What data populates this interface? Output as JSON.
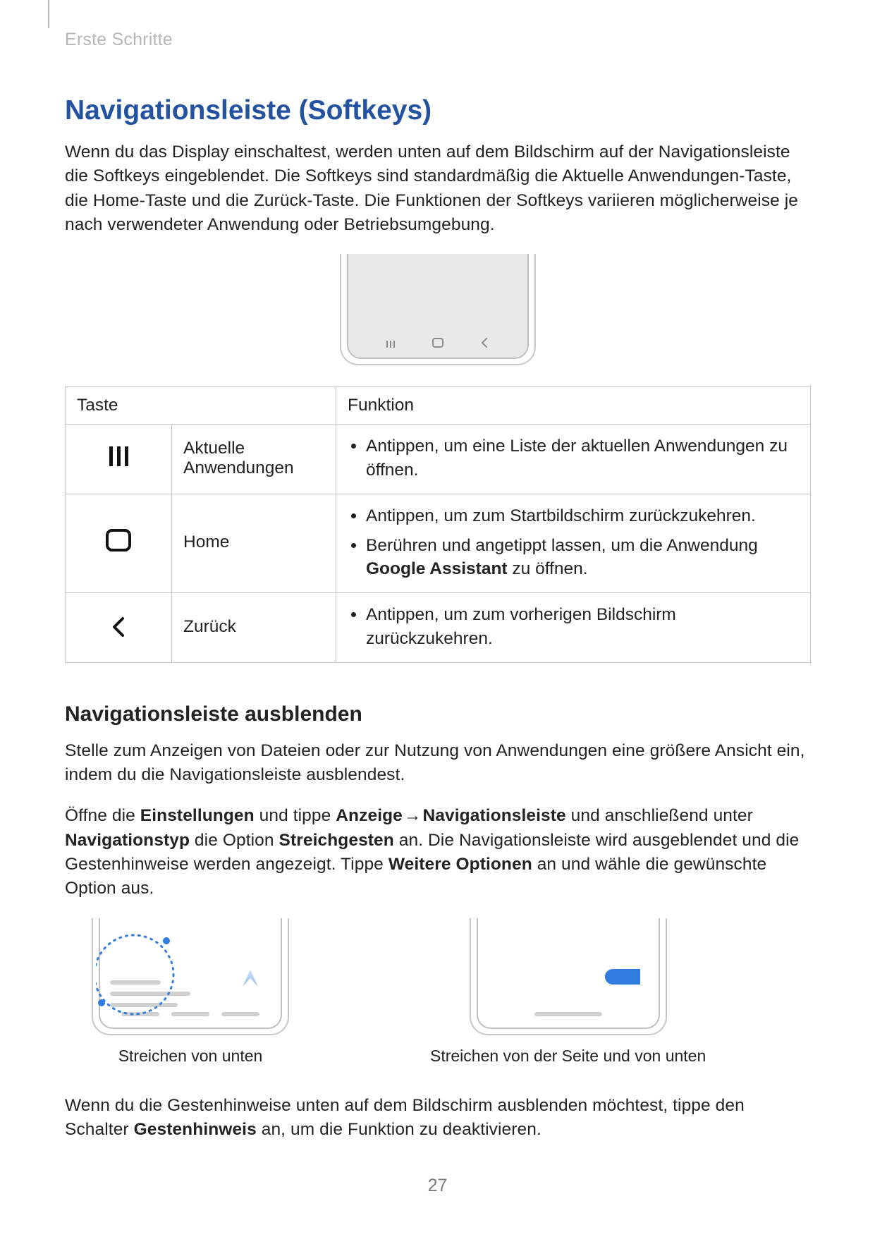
{
  "breadcrumb": "Erste Schritte",
  "title": "Navigationsleiste (Softkeys)",
  "intro": "Wenn du das Display einschaltest, werden unten auf dem Bildschirm auf der Navigationsleiste die Softkeys eingeblendet. Die Softkeys sind standardmäßig die Aktuelle Anwendungen-Taste, die Home-Taste und die Zurück-Taste. Die Funktionen der Softkeys variieren möglicherweise je nach verwendeter Anwendung oder Betriebsumgebung.",
  "table": {
    "head_key": "Taste",
    "head_func": "Funktion",
    "rows": [
      {
        "label": "Aktuelle Anwendungen",
        "funcs": [
          "Antippen, um eine Liste der aktuellen Anwendungen zu öffnen."
        ]
      },
      {
        "label": "Home",
        "funcs": [
          "Antippen, um zum Startbildschirm zurückzukehren.",
          "__HOME_LONGPRESS__"
        ],
        "home_longpress_pre": "Berühren und angetippt lassen, um die Anwendung ",
        "home_longpress_b1": "Google Assistant",
        "home_longpress_post": " zu öffnen."
      },
      {
        "label": "Zurück",
        "funcs": [
          "Antippen, um zum vorherigen Bildschirm zurückzukehren."
        ]
      }
    ]
  },
  "hide_nav": {
    "heading": "Navigationsleiste ausblenden",
    "p1": "Stelle zum Anzeigen von Dateien oder zur Nutzung von Anwendungen eine größere Ansicht ein, indem du die Navigationsleiste ausblendest.",
    "p2_pre": "Öffne die ",
    "p2_b1": "Einstellungen",
    "p2_mid1": " und tippe ",
    "p2_b2": "Anzeige",
    "p2_arrow": " → ",
    "p2_b3": "Navigationsleiste",
    "p2_mid2": " und anschließend unter ",
    "p2_b4": "Navigationstyp",
    "p2_mid3": " die Option ",
    "p2_b5": "Streichgesten",
    "p2_mid4": " an. Die Navigationsleiste wird ausgeblendet und die Gestenhinweise werden angezeigt. Tippe ",
    "p2_b6": "Weitere Optionen",
    "p2_post": " an und wähle die gewünschte Option aus.",
    "caption_a": "Streichen von unten",
    "caption_b": "Streichen von der Seite und von unten",
    "p3_pre": "Wenn du die Gestenhinweise unten auf dem Bildschirm ausblenden möchtest, tippe den Schalter ",
    "p3_b1": "Gestenhinweis",
    "p3_post": " an, um die Funktion zu deaktivieren."
  },
  "page_number": "27"
}
